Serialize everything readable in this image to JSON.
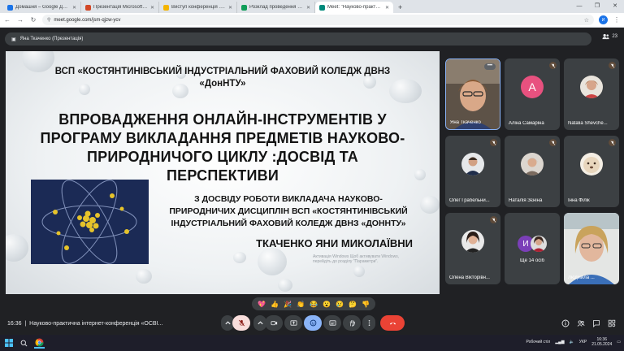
{
  "browser": {
    "tabs": [
      {
        "title": "Домашня – Google Диск",
        "color": "#1a73e8"
      },
      {
        "title": "Презентація Microsoft PowerPoint",
        "color": "#d24726"
      },
      {
        "title": "Виступ конференція .pptx - G",
        "color": "#f4b400"
      },
      {
        "title": "Розклад проведення конфере",
        "color": "#0f9d58"
      },
      {
        "title": "Meet: \"Науково-практичн",
        "color": "#00897b"
      }
    ],
    "new_tab": "+",
    "url": "meet.google.com/jsm-qjzw-ycv",
    "profile_initial": "И",
    "window_controls": [
      "—",
      "❐",
      "✕"
    ]
  },
  "meet": {
    "presenter_label": "Яна Ткаченко (Презентація)",
    "people_count": "23",
    "meeting_time": "16:36",
    "meeting_title": "Науково-практична інтернет-конференція «ОСВІ...",
    "reactions": [
      "💖",
      "👍",
      "🎉",
      "👏",
      "😂",
      "😮",
      "😢",
      "🤔",
      "👎"
    ],
    "participants": [
      {
        "name": "Яна Ткаченко",
        "type": "video"
      },
      {
        "name": "Аліна Самаріна",
        "type": "letter",
        "initial": "A",
        "color": "#e8517f"
      },
      {
        "name": "Natalia Shevche...",
        "type": "photo"
      },
      {
        "name": "Олег Грабельни...",
        "type": "photo"
      },
      {
        "name": "Наталія Зєніна",
        "type": "photo"
      },
      {
        "name": "Інна Філік",
        "type": "photo"
      },
      {
        "name": "Олена Вікторівн...",
        "type": "photo"
      },
      {
        "name": "Ще 14 осіб",
        "type": "group",
        "initial": "И"
      },
      {
        "name": "Людмила ...",
        "type": "video"
      }
    ],
    "more_dots": "•••"
  },
  "slide": {
    "institution": "ВСП «КОСТЯНТИНІВСЬКИЙ ІНДУСТРІАЛЬНИЙ ФАХОВИЙ КОЛЕДЖ  ДВНЗ «ДонНТУ»",
    "title": "ВПРОВАДЖЕННЯ ОНЛАЙН-ІНСТРУМЕНТІВ У ПРОГРАМУ ВИКЛАДАННЯ ПРЕДМЕТІВ НАУКОВО-ПРИРОДНИЧОГО ЦИКЛУ :ДОСВІД ТА ПЕРСПЕКТИВИ",
    "subtitle": "З ДОСВІДУ РОБОТИ ВИКЛАДАЧА НАУКОВО-ПРИРОДНИЧИХ ДИСЦИПЛІН ВСП «КОСТЯНТИНІВСЬКИЙ ІНДУСТРІАЛЬНИЙ ФАХОВИЙ КОЛЕДЖ  ДВНЗ «ДОННТУ»",
    "author": "ТКАЧЕНКО ЯНИ МИКОЛАЇВНИ",
    "watermark": "Активація Windows  Щоб активувати Windows, перейдіть до розділу \"Параметри\"."
  },
  "taskbar": {
    "search_placeholder": "Пошук",
    "tray_label": "Робочий стіл",
    "language": "УКР",
    "clock_time": "16:36",
    "clock_date": "21.05.2024"
  },
  "colors": {
    "meet_bg": "#202124",
    "tile_bg": "#3c4043",
    "end_call": "#ea4335",
    "active_control": "#8ab4f8"
  }
}
